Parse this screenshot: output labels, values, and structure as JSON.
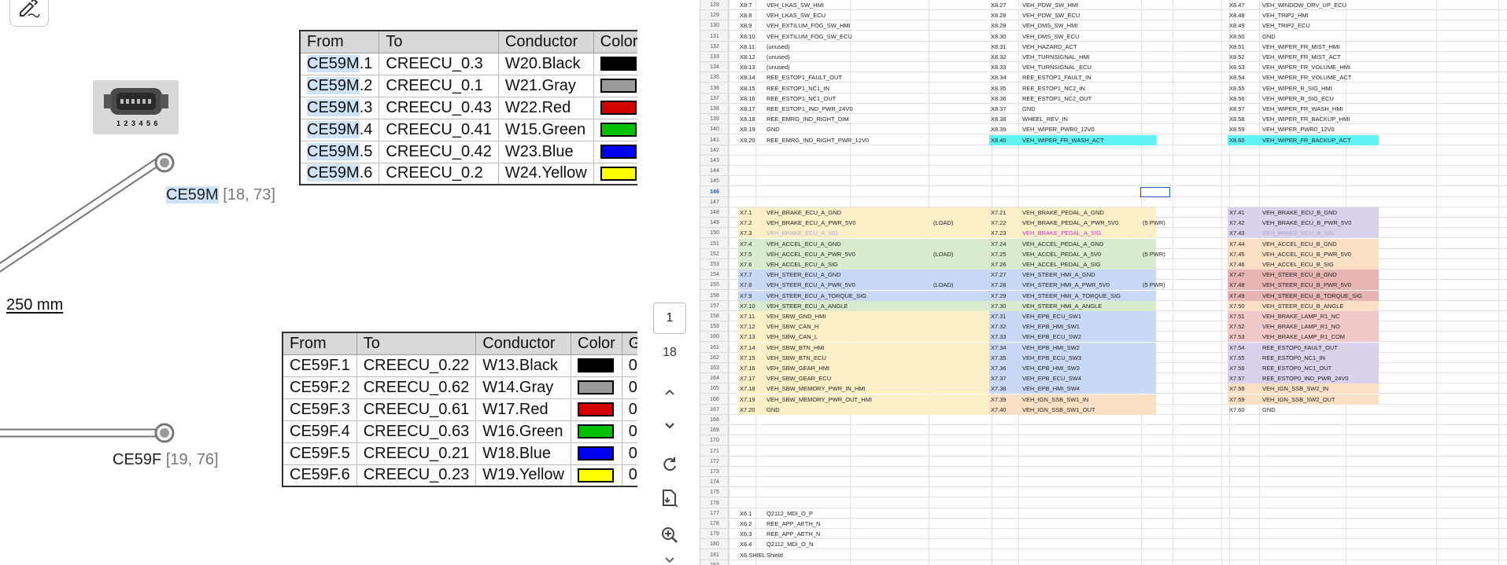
{
  "diagram": {
    "connector_m": {
      "name": "CE59M",
      "coords": "[18, 73]"
    },
    "connector_f": {
      "name": "CE59F",
      "coords": "[19, 76]"
    },
    "connector_pins": "1 2 3 4 5 6",
    "length": "250 mm",
    "table_m": {
      "headers": [
        "From",
        "To",
        "Conductor",
        "Color"
      ],
      "rows": [
        {
          "from_hl": "CE59M",
          "from_rest": ".1",
          "to": "CREECU_0.3",
          "conductor": "W20.Black",
          "color": "#000000"
        },
        {
          "from_hl": "CE59M",
          "from_rest": ".2",
          "to": "CREECU_0.1",
          "conductor": "W21.Gray",
          "color": "#9a9a9a"
        },
        {
          "from_hl": "CE59M",
          "from_rest": ".3",
          "to": "CREECU_0.43",
          "conductor": "W22.Red",
          "color": "#d40000"
        },
        {
          "from_hl": "CE59M",
          "from_rest": ".4",
          "to": "CREECU_0.41",
          "conductor": "W15.Green",
          "color": "#00c000"
        },
        {
          "from_hl": "CE59M",
          "from_rest": ".5",
          "to": "CREECU_0.42",
          "conductor": "W23.Blue",
          "color": "#0000f0"
        },
        {
          "from_hl": "CE59M",
          "from_rest": ".6",
          "to": "CREECU_0.2",
          "conductor": "W24.Yellow",
          "color": "#ffff00"
        }
      ]
    },
    "table_f": {
      "headers": [
        "From",
        "To",
        "Conductor",
        "Color",
        "G"
      ],
      "rows": [
        {
          "from": "CE59F.1",
          "to": "CREECU_0.22",
          "conductor": "W13.Black",
          "color": "#000000",
          "g": "0."
        },
        {
          "from": "CE59F.2",
          "to": "CREECU_0.62",
          "conductor": "W14.Gray",
          "color": "#9a9a9a",
          "g": "0."
        },
        {
          "from": "CE59F.3",
          "to": "CREECU_0.61",
          "conductor": "W17.Red",
          "color": "#d40000",
          "g": "0."
        },
        {
          "from": "CE59F.4",
          "to": "CREECU_0.63",
          "conductor": "W16.Green",
          "color": "#00c000",
          "g": "0."
        },
        {
          "from": "CE59F.5",
          "to": "CREECU_0.21",
          "conductor": "W18.Blue",
          "color": "#0000f0",
          "g": "0."
        },
        {
          "from": "CE59F.6",
          "to": "CREECU_0.23",
          "conductor": "W19.Yellow",
          "color": "#ffff00",
          "g": "0."
        }
      ]
    }
  },
  "toolbar": {
    "page_current": "1",
    "page_total": "18",
    "icons": [
      "sign-icon",
      "chevron-up-icon",
      "chevron-down-icon",
      "refresh-icon",
      "save-pdf-icon",
      "zoom-in-icon"
    ]
  },
  "sheet": {
    "active_row": "146",
    "colors": {
      "cyan": "#5ff3f3",
      "yellow": "#fdf0c8",
      "green": "#d8ebce",
      "blue": "#c9d8f5",
      "purple": "#d9d2ea",
      "orange": "#fbe0c6",
      "red": "#f1c9c9",
      "salmon": "#e8b4b4"
    },
    "rows": [
      {
        "n": "128",
        "cells": [
          [
            "X8.7",
            "VEH_LKAS_SW_HMI"
          ],
          [
            "X8.27",
            "VEH_PDW_SW_HMI"
          ],
          [
            "X8.47",
            "VEH_WINDOW_DRV_UP_ECU"
          ]
        ]
      },
      {
        "n": "129",
        "cells": [
          [
            "X8.8",
            "VEH_LKAS_SW_ECU"
          ],
          [
            "X8.28",
            "VEH_PDW_SW_ECU"
          ],
          [
            "X8.48",
            "VEH_TRIP2_HMI"
          ]
        ]
      },
      {
        "n": "130",
        "cells": [
          [
            "X8.9",
            "VEH_EXTILUM_FOG_SW_HMI"
          ],
          [
            "X8.29",
            "VEH_DMS_SW_HMI"
          ],
          [
            "X8.49",
            "VEH_TRIP2_ECU"
          ]
        ]
      },
      {
        "n": "131",
        "cells": [
          [
            "X8.10",
            "VEH_EXTILUM_FOG_SW_ECU"
          ],
          [
            "X8.30",
            "VEH_DMS_SW_ECU"
          ],
          [
            "X8.50",
            "GND"
          ]
        ]
      },
      {
        "n": "132",
        "cells": [
          [
            "X8.11",
            "(unused)"
          ],
          [
            "X8.31",
            "VEH_HAZARD_ACT"
          ],
          [
            "X8.51",
            "VEH_WIPER_FR_MIST_HMI"
          ]
        ]
      },
      {
        "n": "133",
        "cells": [
          [
            "X8.12",
            "(unused)"
          ],
          [
            "X8.32",
            "VEH_TURNSIGNAL_HMI"
          ],
          [
            "X8.52",
            "VEH_WIPER_FR_MIST_ACT"
          ]
        ]
      },
      {
        "n": "134",
        "cells": [
          [
            "X8.13",
            "(unused)"
          ],
          [
            "X8.33",
            "VEH_TURNSIGNAL_ECU"
          ],
          [
            "X8.53",
            "VEH_WIPER_FR_VOLUME_HMI"
          ]
        ]
      },
      {
        "n": "135",
        "cells": [
          [
            "X8.14",
            "REE_ESTOP1_FAULT_OUT"
          ],
          [
            "X8.34",
            "REE_ESTOP1_FAULT_IN"
          ],
          [
            "X8.54",
            "VEH_WIPER_FR_VOLUME_ACT"
          ]
        ]
      },
      {
        "n": "136",
        "cells": [
          [
            "X8.15",
            "REE_ESTOP1_NC1_IN"
          ],
          [
            "X8.35",
            "REE_ESTOP1_NC2_IN"
          ],
          [
            "X8.55",
            "VEH_WIPER_R_SIG_HMI"
          ]
        ]
      },
      {
        "n": "137",
        "cells": [
          [
            "X8.16",
            "REE_ESTOP1_NC1_OUT"
          ],
          [
            "X8.36",
            "REE_ESTOP1_NC2_OUT"
          ],
          [
            "X8.56",
            "VEH_WIPER_R_SIG_ECU"
          ]
        ]
      },
      {
        "n": "138",
        "cells": [
          [
            "X8.17",
            "REE_ESTOP1_IND_PWR_24V0"
          ],
          [
            "X8.37",
            "GND"
          ],
          [
            "X8.57",
            "VEH_WIPER_FR_WASH_HMI"
          ]
        ]
      },
      {
        "n": "139",
        "cells": [
          [
            "X8.18",
            "REE_EMRG_IND_RIGHT_DIM"
          ],
          [
            "X8.38",
            "WHEEL_REV_IN"
          ],
          [
            "X8.58",
            "VEH_WIPER_FR_BACKUP_HMI"
          ]
        ]
      },
      {
        "n": "140",
        "cells": [
          [
            "X8.19",
            "GND"
          ],
          [
            "X8.39",
            "VEH_WIPER_PWR0_12V0"
          ],
          [
            "X8.59",
            "VEH_WIPER_PWR0_12V0"
          ]
        ]
      },
      {
        "n": "141",
        "cells": [
          [
            "X8.20",
            "REE_EMRG_IND_RIGHT_PWR_12V0"
          ],
          [
            "X8.40",
            "VEH_WIPER_FR_WASH_ACT"
          ],
          [
            "X8.60",
            "VEH_WIPER_FR_BACKUP_ACT"
          ]
        ],
        "fill": [
          "",
          "cyan",
          "cyan"
        ]
      },
      {
        "n": "142",
        "cells": []
      },
      {
        "n": "143",
        "cells": []
      },
      {
        "n": "144",
        "cells": []
      },
      {
        "n": "145",
        "cells": []
      },
      {
        "n": "146",
        "cells": []
      },
      {
        "n": "147",
        "cells": []
      },
      {
        "n": "148",
        "cells": [
          [
            "X7.1",
            "VEH_BRAKE_ECU_A_GND"
          ],
          [
            "X7.21",
            "VEH_BRAKE_PEDAL_A_GND"
          ],
          [
            "X7.41",
            "VEH_BRAKE_ECU_B_GND"
          ]
        ],
        "fill": [
          "yellow",
          "yellow",
          "purple"
        ]
      },
      {
        "n": "149",
        "cells": [
          [
            "X7.2",
            "VEH_BRAKE_ECU_A_PWR_5V0"
          ],
          [
            "X7.22",
            "VEH_BRAKE_PEDAL_A_PWR_5V0"
          ],
          [
            "X7.42",
            "VEH_BRAKE_ECU_B_PWR_5V0"
          ]
        ],
        "fill": [
          "yellow",
          "yellow",
          "purple"
        ],
        "notes": [
          "(LOAD)",
          "(5 PWR)"
        ]
      },
      {
        "n": "150",
        "cells": [
          [
            "X7.3",
            "VEH_BRAKE_ECU_A_SIG"
          ],
          [
            "X7.23",
            "VEH_BRAKE_PEDAL_A_SIG"
          ],
          [
            "X7.43",
            "VEH_BRAKE_ECU_B_SIG"
          ]
        ],
        "fill": [
          "yellow",
          "yellow",
          "purple"
        ],
        "tint": [
          "#a8a8c8",
          "#d030d0",
          "#a8a8c8"
        ]
      },
      {
        "n": "151",
        "cells": [
          [
            "X7.4",
            "VEH_ACCEL_ECU_A_GND"
          ],
          [
            "X7.24",
            "VEH_ACCEL_PEDAL_A_GND"
          ],
          [
            "X7.44",
            "VEH_ACCEL_ECU_B_GND"
          ]
        ],
        "fill": [
          "green",
          "green",
          "orange"
        ]
      },
      {
        "n": "152",
        "cells": [
          [
            "X7.5",
            "VEH_ACCEL_ECU_A_PWR_5V0"
          ],
          [
            "X7.25",
            "VEH_ACCEL_PEDAL_A_5V0"
          ],
          [
            "X7.45",
            "VEH_ACCEL_ECU_B_PWR_5V0"
          ]
        ],
        "fill": [
          "green",
          "green",
          "orange"
        ],
        "notes": [
          "(LOAD)",
          "(5 PWR)"
        ]
      },
      {
        "n": "153",
        "cells": [
          [
            "X7.6",
            "VEH_ACCEL_ECU_A_SIG"
          ],
          [
            "X7.26",
            "VEH_ACCEL_PEDAL_A_SIG"
          ],
          [
            "X7.46",
            "VEH_ACCEL_ECU_B_SIG"
          ]
        ],
        "fill": [
          "green",
          "green",
          "orange"
        ]
      },
      {
        "n": "154",
        "cells": [
          [
            "X7.7",
            "VEH_STEER_ECU_A_GND"
          ],
          [
            "X7.27",
            "VEH_STEER_HMI_A_GND"
          ],
          [
            "X7.47",
            "VEH_STEER_ECU_B_GND"
          ]
        ],
        "fill": [
          "blue",
          "blue",
          "salmon"
        ]
      },
      {
        "n": "155",
        "cells": [
          [
            "X7.8",
            "VEH_STEER_ECU_A_PWR_5V0"
          ],
          [
            "X7.28",
            "VEH_STEER_HMI_A_PWR_5V0"
          ],
          [
            "X7.48",
            "VEH_STEER_ECU_B_PWR_5V0"
          ]
        ],
        "fill": [
          "blue",
          "blue",
          "salmon"
        ],
        "notes": [
          "(LOAD)",
          "(5 PWR)"
        ]
      },
      {
        "n": "156",
        "cells": [
          [
            "X7.9",
            "VEH_STEER_ECU_A_TORQUE_SIG"
          ],
          [
            "X7.29",
            "VEH_STEER_HMI_A_TORQUE_SIG"
          ],
          [
            "X7.49",
            "VEH_STEER_ECU_B_TORQUE_SIG"
          ]
        ],
        "fill": [
          "blue",
          "blue",
          "salmon"
        ]
      },
      {
        "n": "157",
        "cells": [
          [
            "X7.10",
            "VEH_STEER_ECU_A_ANGLE"
          ],
          [
            "X7.30",
            "VEH_STEER_HMI_A_ANGLE"
          ],
          [
            "X7.50",
            "VEH_STEER_ECU_B_ANGLE"
          ]
        ],
        "fill": [
          "green",
          "green",
          "orange"
        ]
      },
      {
        "n": "158",
        "cells": [
          [
            "X7.11",
            "VEH_SBW_GND_HMI"
          ],
          [
            "X7.31",
            "VEH_EPB_ECU_SW1"
          ],
          [
            "X7.51",
            "VEH_BRAKE_LAMP_R1_NC"
          ]
        ],
        "fill": [
          "yellow",
          "blue",
          "red"
        ]
      },
      {
        "n": "159",
        "cells": [
          [
            "X7.12",
            "VEH_SBW_CAN_H"
          ],
          [
            "X7.32",
            "VEH_EPB_HMI_SW1"
          ],
          [
            "X7.52",
            "VEH_BRAKE_LAMP_R1_NO"
          ]
        ],
        "fill": [
          "yellow",
          "blue",
          "red"
        ]
      },
      {
        "n": "160",
        "cells": [
          [
            "X7.13",
            "VEH_SBW_CAN_L"
          ],
          [
            "X7.33",
            "VEH_EPB_ECU_SW2"
          ],
          [
            "X7.53",
            "VEH_BRAKE_LAMP_R1_COM"
          ]
        ],
        "fill": [
          "yellow",
          "blue",
          "red"
        ]
      },
      {
        "n": "161",
        "cells": [
          [
            "X7.14",
            "VEH_SBW_BTN_HMI"
          ],
          [
            "X7.34",
            "VEH_EPB_HMI_SW2"
          ],
          [
            "X7.54",
            "REE_ESTOP0_FAULT_OUT"
          ]
        ],
        "fill": [
          "yellow",
          "blue",
          "purple"
        ]
      },
      {
        "n": "162",
        "cells": [
          [
            "X7.15",
            "VEH_SBW_BTN_ECU"
          ],
          [
            "X7.35",
            "VEH_EPB_ECU_SW3"
          ],
          [
            "X7.55",
            "REE_ESTOP0_NC1_IN"
          ]
        ],
        "fill": [
          "yellow",
          "blue",
          "purple"
        ]
      },
      {
        "n": "163",
        "cells": [
          [
            "X7.16",
            "VEH_SBW_GEAR_HMI"
          ],
          [
            "X7.36",
            "VEH_EPB_HMI_SW3"
          ],
          [
            "X7.56",
            "REE_ESTOP0_NC1_OUT"
          ]
        ],
        "fill": [
          "yellow",
          "blue",
          "purple"
        ]
      },
      {
        "n": "164",
        "cells": [
          [
            "X7.17",
            "VEH_SBW_GEAR_ECU"
          ],
          [
            "X7.37",
            "VEH_EPB_ECU_SW4"
          ],
          [
            "X7.57",
            "REE_ESTOP0_IND_PWR_24V0"
          ]
        ],
        "fill": [
          "yellow",
          "blue",
          "purple"
        ]
      },
      {
        "n": "165",
        "cells": [
          [
            "X7.18",
            "VEH_SBW_MEMORY_PWR_IN_HMI"
          ],
          [
            "X7.38",
            "VEH_EPB_HMI_SW4"
          ],
          [
            "X7.58",
            "VEH_IGN_SSB_SW2_IN"
          ]
        ],
        "fill": [
          "yellow",
          "blue",
          "orange"
        ]
      },
      {
        "n": "166",
        "cells": [
          [
            "X7.19",
            "VEH_SBW_MEMORY_PWR_OUT_HMI"
          ],
          [
            "X7.39",
            "VEH_IGN_SSB_SW1_IN"
          ],
          [
            "X7.59",
            "VEH_IGN_SSB_SW2_OUT"
          ]
        ],
        "fill": [
          "yellow",
          "orange",
          "orange"
        ]
      },
      {
        "n": "167",
        "cells": [
          [
            "X7.20",
            "GND"
          ],
          [
            "X7.40",
            "VEH_IGN_SSB_SW1_OUT"
          ],
          [
            "X7.60",
            "GND"
          ]
        ],
        "fill": [
          "yellow",
          "orange",
          ""
        ]
      },
      {
        "n": "168",
        "cells": []
      },
      {
        "n": "169",
        "cells": []
      },
      {
        "n": "170",
        "cells": []
      },
      {
        "n": "171",
        "cells": []
      },
      {
        "n": "172",
        "cells": []
      },
      {
        "n": "173",
        "cells": []
      },
      {
        "n": "174",
        "cells": []
      },
      {
        "n": "175",
        "cells": []
      },
      {
        "n": "176",
        "cells": []
      },
      {
        "n": "177",
        "cells": [
          [
            "X6.1",
            "Q2112_MDI_O_P"
          ]
        ]
      },
      {
        "n": "178",
        "cells": [
          [
            "X6.2",
            "REE_APP_AETH_N"
          ]
        ]
      },
      {
        "n": "179",
        "cells": [
          [
            "X6.3",
            "REE_APP_AETH_N"
          ]
        ]
      },
      {
        "n": "180",
        "cells": [
          [
            "X6.4",
            "Q2112_MDI_O_N"
          ]
        ]
      },
      {
        "n": "181",
        "cells": [
          [
            "X6.SHIELD",
            "Shield"
          ]
        ]
      },
      {
        "n": "182",
        "cells": []
      }
    ]
  }
}
